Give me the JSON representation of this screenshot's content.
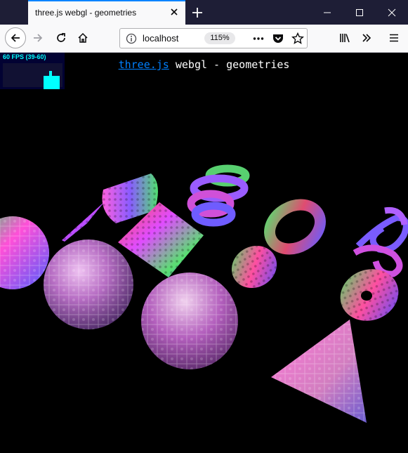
{
  "browser": {
    "tab_title": "three.js webgl - geometries",
    "url": "localhost",
    "zoom": "115%"
  },
  "page": {
    "link_text": "three.js",
    "title_rest": " webgl - geometries"
  },
  "stats": {
    "fps_text": "60 FPS (39-60)"
  },
  "colors": {
    "tab_strip": "#1e1e36",
    "accent": "#0a84ff",
    "link": "#0080ff",
    "stats_text": "#00ffff",
    "stats_bg": "#020233"
  }
}
